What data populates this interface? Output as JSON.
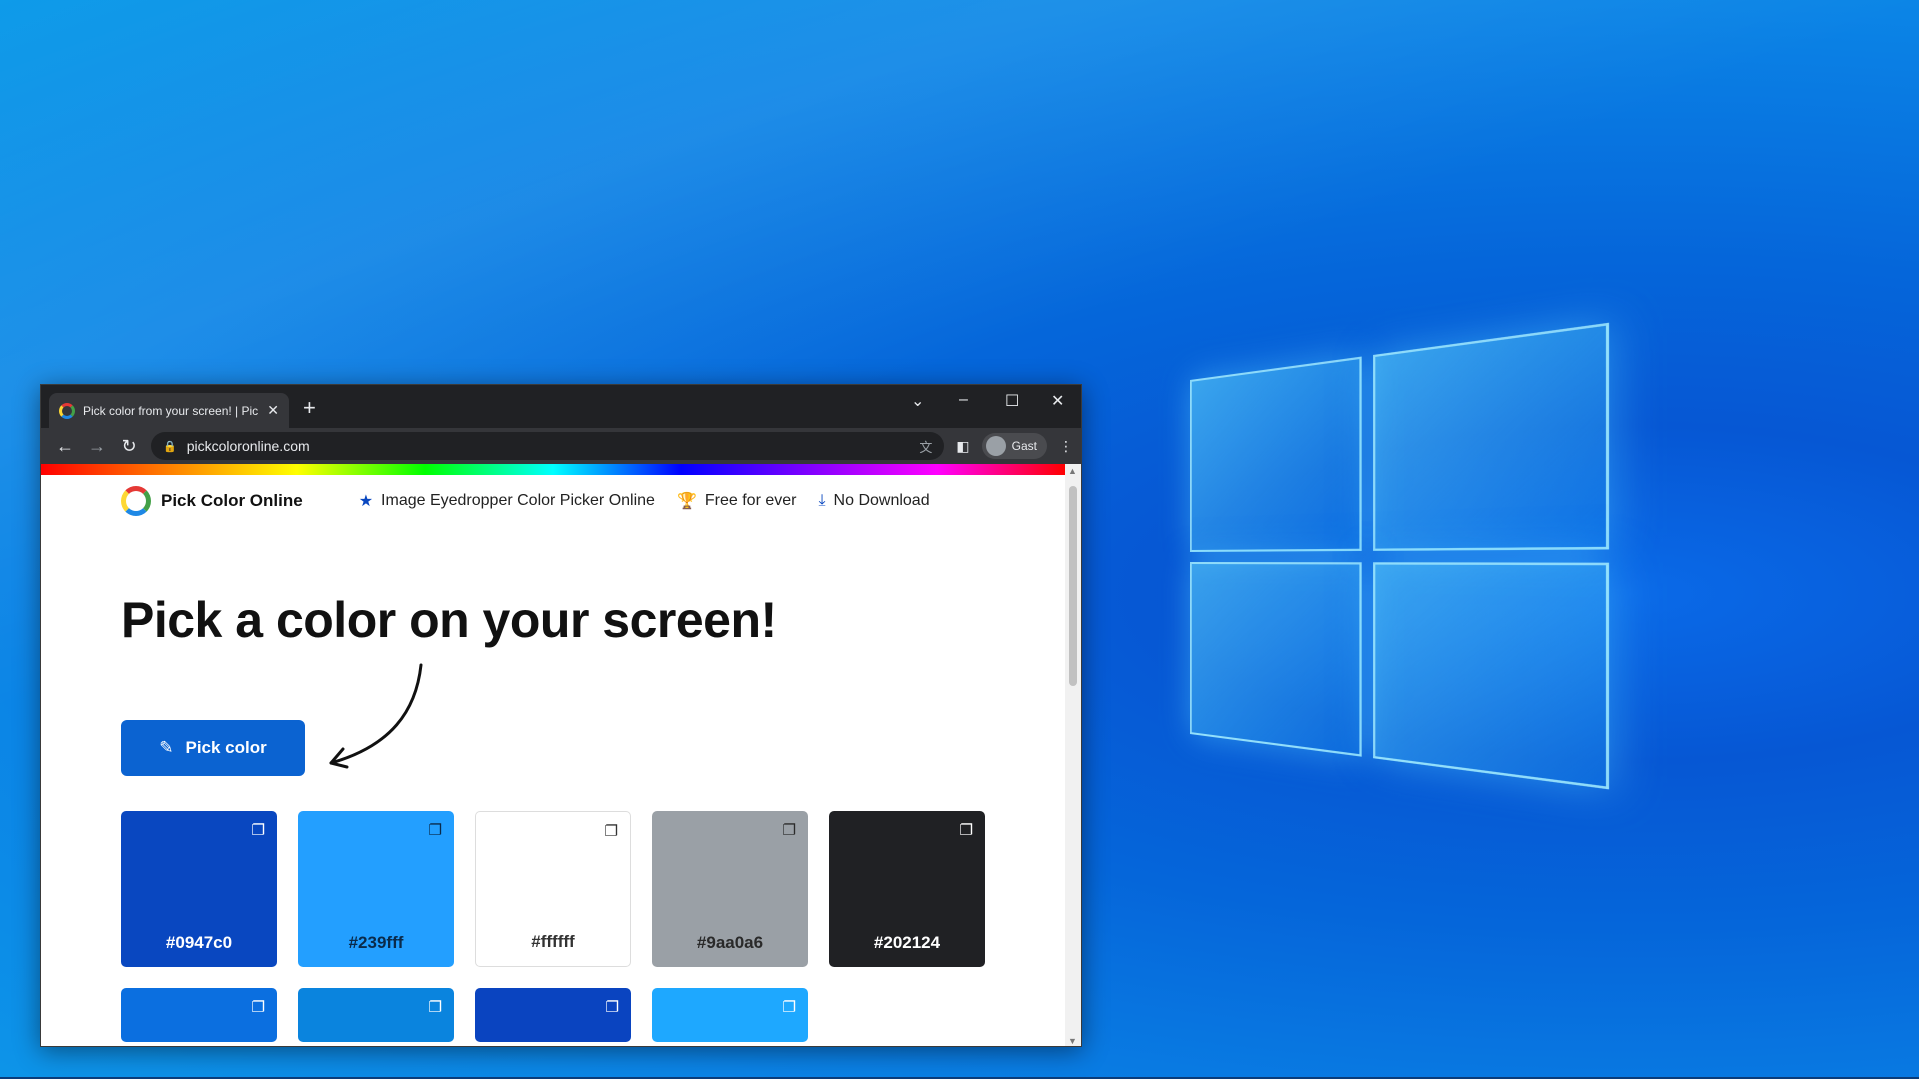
{
  "browser": {
    "tab_title": "Pick color from your screen! | Pic",
    "url": "pickcoloronline.com",
    "profile_label": "Gast"
  },
  "site": {
    "logo_text": "Pick Color Online",
    "nav": [
      {
        "label": "Image Eyedropper Color Picker Online",
        "icon": "star-icon"
      },
      {
        "label": "Free for ever",
        "icon": "trophy-icon"
      },
      {
        "label": "No Download",
        "icon": "download-icon"
      }
    ],
    "hero_title": "Pick a color on your screen!",
    "pick_button_label": "Pick color",
    "swatches": [
      {
        "hex": "#0947c0",
        "label": "#0947c0",
        "text_color": "#ffffff"
      },
      {
        "hex": "#239fff",
        "label": "#239fff",
        "text_color": "#0a2a4a"
      },
      {
        "hex": "#ffffff",
        "label": "#ffffff",
        "text_color": "#333333"
      },
      {
        "hex": "#9aa0a6",
        "label": "#9aa0a6",
        "text_color": "#2a2a2a"
      },
      {
        "hex": "#202124",
        "label": "#202124",
        "text_color": "#ffffff"
      }
    ],
    "swatches_row2": [
      {
        "hex": "#0b6fe0"
      },
      {
        "hex": "#0a84de"
      },
      {
        "hex": "#0a44c0"
      },
      {
        "hex": "#1ea8ff"
      }
    ]
  }
}
